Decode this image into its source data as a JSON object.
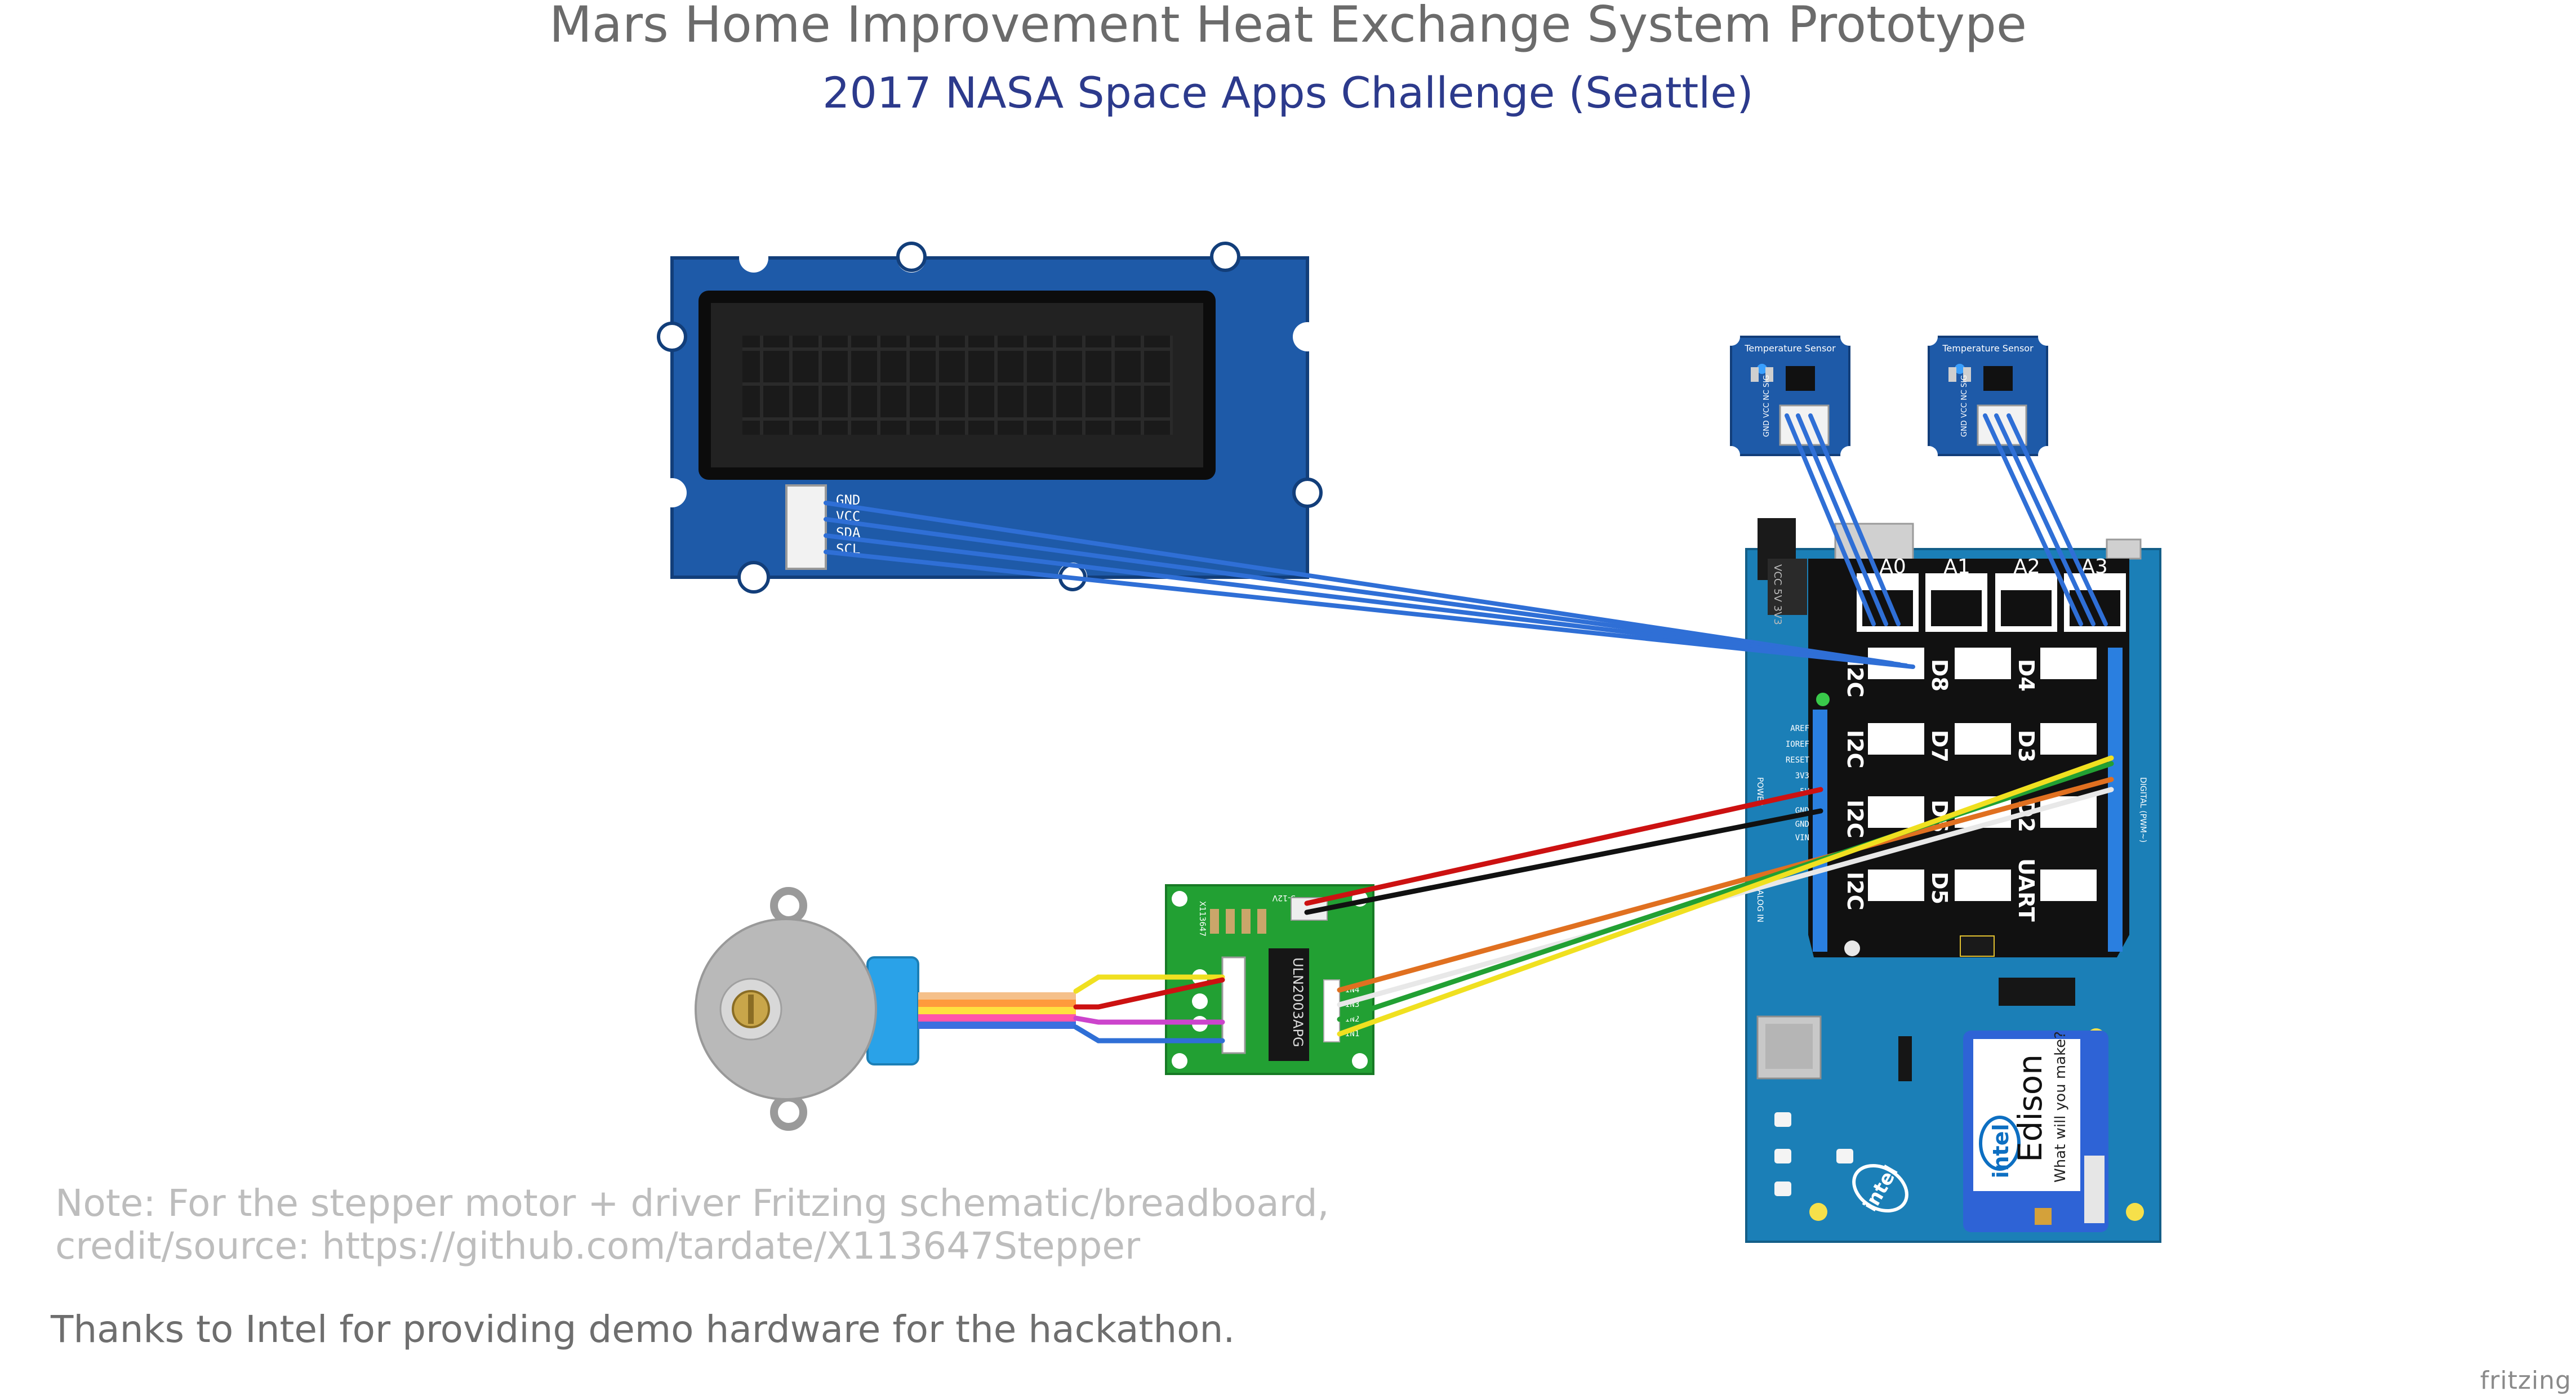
{
  "title": "Mars Home Improvement Heat Exchange System Prototype",
  "subtitle": "2017 NASA Space Apps Challenge (Seattle)",
  "note_line1": "Note: For the stepper motor + driver Fritzing schematic/breadboard,",
  "note_line2": "credit/source: https://github.com/tardate/X113647Stepper",
  "thanks": "Thanks to Intel for providing demo hardware for the hackathon.",
  "watermark": "fritzing",
  "lcd": {
    "pins": [
      "GND",
      "VCC",
      "SDA",
      "SCL"
    ]
  },
  "sensors": [
    {
      "label": "Temperature Sensor",
      "pins": "GND VCC NC SIG"
    },
    {
      "label": "Temperature Sensor",
      "pins": "GND VCC NC SIG"
    }
  ],
  "driver": {
    "chip": "ULN2003APG",
    "board": "X113647",
    "pins": [
      "IN4",
      "IN3",
      "IN2",
      "IN1"
    ],
    "power": [
      "5-12V",
      "-",
      "+"
    ]
  },
  "shield": {
    "analog_ports": [
      "A0",
      "A1",
      "A2",
      "A3"
    ],
    "grid_ports": [
      [
        "I2C",
        "D8",
        "D4"
      ],
      [
        "I2C",
        "D7",
        "D3"
      ],
      [
        "I2C",
        "D6",
        "D2"
      ],
      [
        "I2C",
        "D5",
        "UART"
      ]
    ],
    "left_header": [
      "AREF",
      "IOREF",
      "RESET",
      "3V3",
      "5V",
      "GND",
      "GND",
      "VIN"
    ],
    "side_labels": {
      "power": "POWER",
      "analog": "ANALOG IN",
      "digital": "DIGITAL (PWM~)"
    },
    "vcc_label": "VCC 5V 3V3"
  },
  "edison": {
    "brand": "intel",
    "name": "Edison",
    "tagline": "What will you make?"
  },
  "colors": {
    "title": "#6b6b6b",
    "subtitle": "#2c3a8c",
    "lcd_board": "#1e5aa8",
    "shield_black": "#111111",
    "board_blue": "#1b7fb7",
    "wire_blue": "#2f6fd6",
    "driver_green": "#22a033",
    "motor_grey": "#b9b9b9"
  }
}
